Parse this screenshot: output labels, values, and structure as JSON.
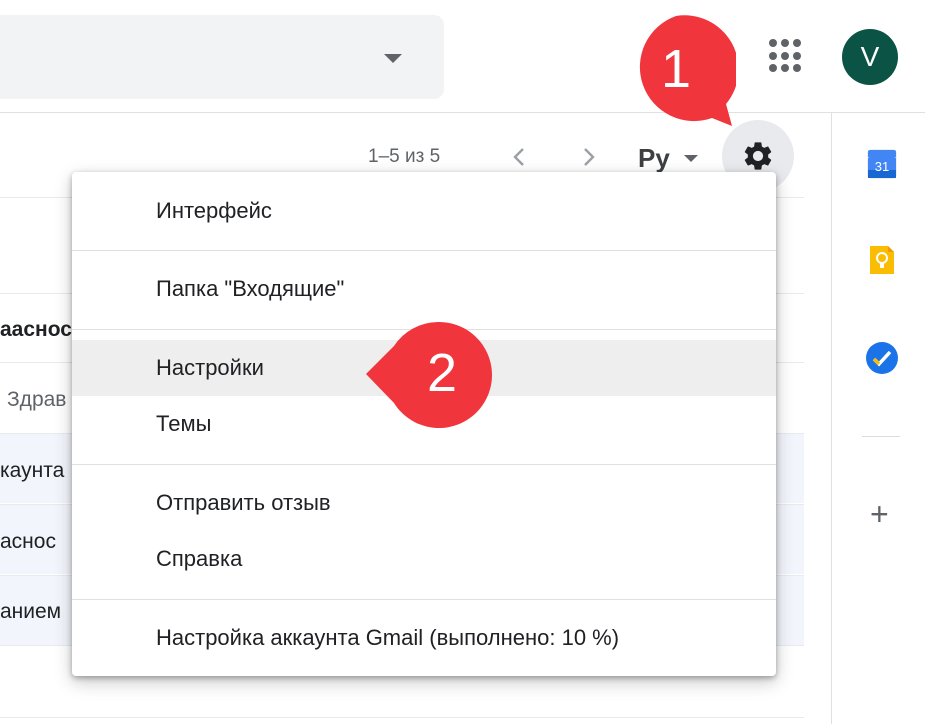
{
  "header": {
    "avatar_letter": "V",
    "icons": [
      "apps-grid-icon",
      "avatar"
    ]
  },
  "toolbar": {
    "pager": "1–5 из 5",
    "language": "Ру"
  },
  "background_rows": {
    "fragments": [
      "аасност",
      "Здрав",
      "каунта",
      "аснос",
      "анием"
    ]
  },
  "settings_menu": {
    "items": [
      {
        "label": "Интерфейс"
      },
      {
        "label": "Папка \"Входящие\""
      },
      {
        "label": "Настройки",
        "highlighted": true
      },
      {
        "label": "Темы"
      },
      {
        "label": "Отправить отзыв"
      },
      {
        "label": "Справка"
      },
      {
        "label": "Настройка аккаунта Gmail (выполнено: 10 %)"
      }
    ]
  },
  "side_panel": {
    "calendar_day": "31",
    "icons": [
      "calendar-icon",
      "keep-icon",
      "tasks-icon",
      "plus-icon"
    ]
  },
  "callouts": [
    "1",
    "2"
  ],
  "colors": {
    "callout_red": "#f0353d",
    "avatar_green": "#0b5345",
    "menu_highlight": "#eeeeee"
  }
}
